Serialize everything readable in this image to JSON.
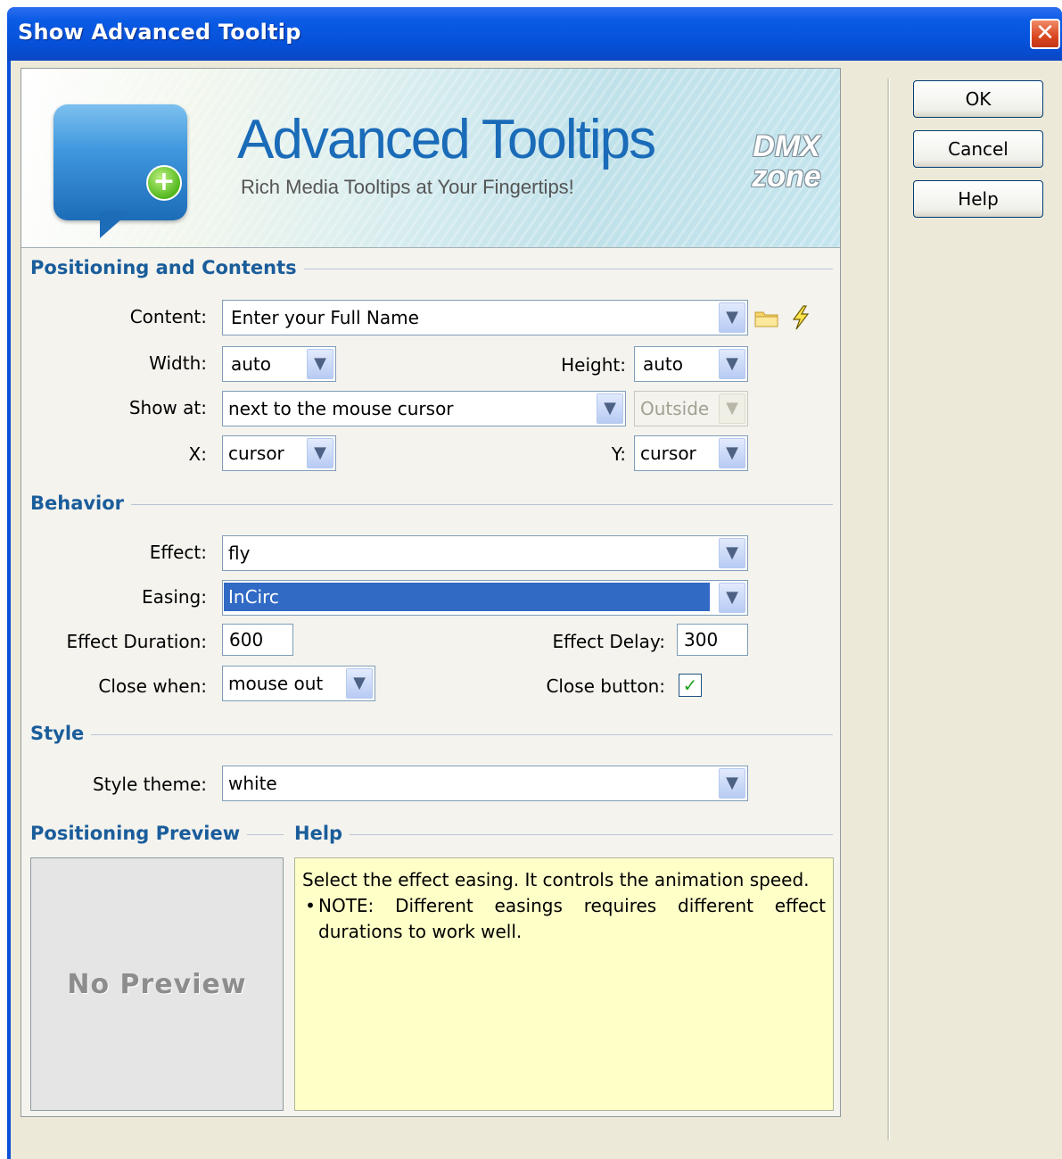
{
  "window": {
    "title": "Show Advanced Tooltip",
    "close_glyph": "✕"
  },
  "banner": {
    "title": "Advanced Tooltips",
    "subtitle": "Rich Media Tooltips at Your Fingertips!",
    "logo_text_1": "DMX",
    "logo_text_2": "zone",
    "plus_glyph": "+"
  },
  "sections": {
    "positioning": "Positioning and Contents",
    "behavior": "Behavior",
    "style": "Style",
    "preview": "Positioning Preview",
    "help": "Help"
  },
  "positioning": {
    "content_label": "Content:",
    "content_value": "Enter your Full Name",
    "width_label": "Width:",
    "width_value": "auto",
    "height_label": "Height:",
    "height_value": "auto",
    "showat_label": "Show at:",
    "showat_value": "next to the mouse cursor",
    "showat_side_value": "Outside",
    "x_label": "X:",
    "x_value": "cursor",
    "y_label": "Y:",
    "y_value": "cursor"
  },
  "behavior": {
    "effect_label": "Effect:",
    "effect_value": "fly",
    "easing_label": "Easing:",
    "easing_value": "InCirc",
    "duration_label": "Effect Duration:",
    "duration_value": "600",
    "delay_label": "Effect Delay:",
    "delay_value": "300",
    "close_when_label": "Close when:",
    "close_when_value": "mouse out",
    "close_button_label": "Close button:",
    "close_button_checked": true,
    "check_glyph": "✓"
  },
  "style": {
    "theme_label": "Style theme:",
    "theme_value": "white"
  },
  "preview": {
    "text": "No Preview"
  },
  "help": {
    "line1": "Select the effect easing. It controls the animation speed.",
    "bullet": "•",
    "note": "NOTE: Different easings requires different effect durations to work well."
  },
  "buttons": {
    "ok": "OK",
    "cancel": "Cancel",
    "help": "Help"
  },
  "icons": {
    "dropdown": "chevron-down-icon",
    "folder": "folder-icon",
    "lightning": "lightning-icon",
    "close": "close-icon",
    "checkbox_check": "check-icon"
  },
  "colors": {
    "titlebar": "#0a5be5",
    "section_header": "#1a5d9b",
    "selection": "#316ac5",
    "help_bg": "#ffffc8"
  }
}
